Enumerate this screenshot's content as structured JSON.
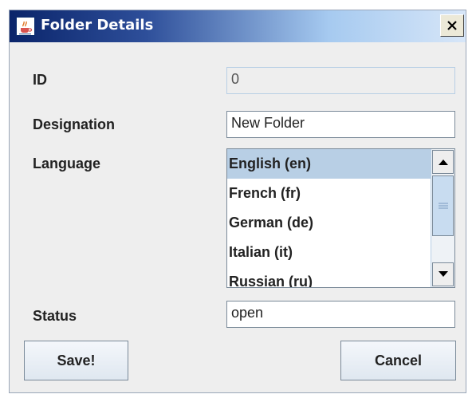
{
  "window": {
    "title": "Folder Details",
    "title_icon": "java-cup-icon",
    "close_label": "✕"
  },
  "form": {
    "id_label": "ID",
    "id_value": "0",
    "designation_label": "Designation",
    "designation_value": "New Folder",
    "language_label": "Language",
    "languages": [
      "English (en)",
      "French (fr)",
      "German (de)",
      "Italian (it)",
      "Russian (ru)"
    ],
    "selected_language": "English (en)",
    "status_label": "Status",
    "status_value": "open"
  },
  "buttons": {
    "save_label": "Save!",
    "cancel_label": "Cancel"
  },
  "colors": {
    "title_gradient_start": "#0a246a",
    "selection": "#b8cfe5",
    "dialog_bg": "#eeeeee"
  }
}
